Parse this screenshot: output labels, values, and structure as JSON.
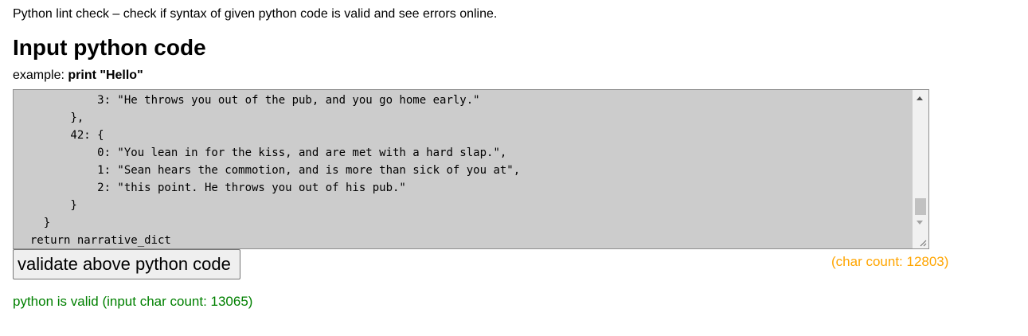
{
  "intro_text": "Python lint check – check if syntax of given python code is valid and see errors online.",
  "heading": "Input python code",
  "example": {
    "label": "example: ",
    "code": "print \"Hello\""
  },
  "editor": {
    "lines": [
      "            3: \"He throws you out of the pub, and you go home early.\"",
      "        },",
      "        42: {",
      "            0: \"You lean in for the kiss, and are met with a hard slap.\",",
      "            1: \"Sean hears the commotion, and is more than sick of you at\",",
      "            2: \"this point. He throws you out of his pub.\"",
      "        }",
      "    }",
      "  return narrative_dict"
    ]
  },
  "validate_button_label": "validate above python code",
  "char_count_text": "(char count: 12803)",
  "status_text": "python is valid (input char count: 13065)",
  "colors": {
    "editor_background": "#cccccc",
    "char_count": "#ffa500",
    "status_valid": "#008000"
  }
}
